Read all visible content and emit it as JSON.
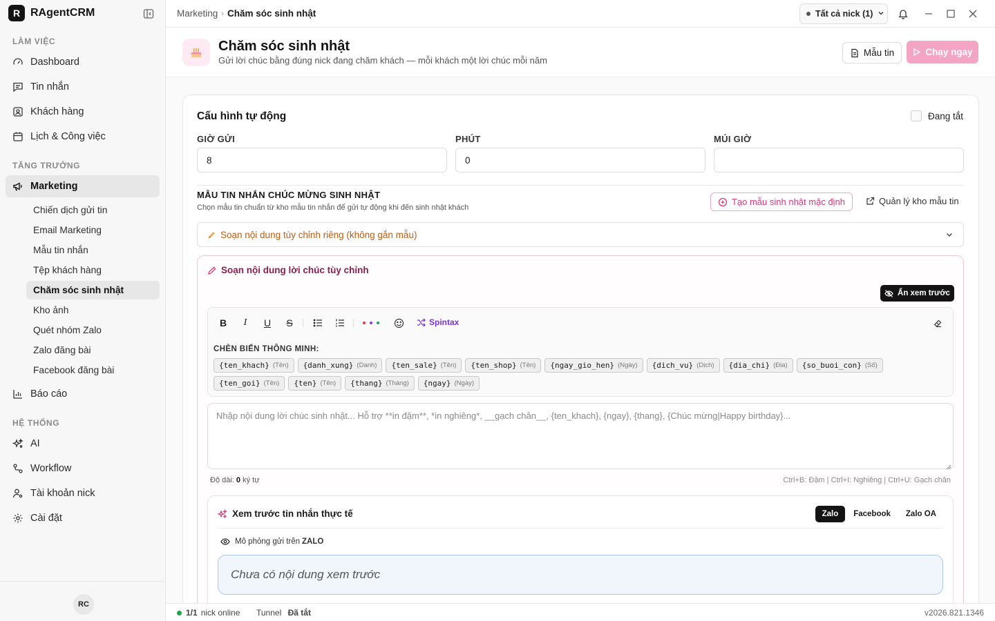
{
  "app": {
    "logo_letter": "R",
    "name": "RAgentCRM"
  },
  "sidebar": {
    "section_work": "LÀM VIỆC",
    "section_growth": "TĂNG TRƯỞNG",
    "section_system": "HỆ THỐNG",
    "items": {
      "dashboard": "Dashboard",
      "messages": "Tin nhắn",
      "customers": "Khách hàng",
      "calendar": "Lịch & Công việc",
      "marketing": "Marketing",
      "reports": "Báo cáo",
      "ai": "AI",
      "workflow": "Workflow",
      "accounts": "Tài khoản nick",
      "settings": "Cài đặt"
    },
    "marketing_sub": {
      "campaign": "Chiến dịch gửi tin",
      "email": "Email Marketing",
      "templates": "Mẫu tin nhắn",
      "segments": "Tệp khách hàng",
      "birthday": "Chăm sóc sinh nhật",
      "images": "Kho ảnh",
      "zalo_groups": "Quét nhóm Zalo",
      "zalo_post": "Zalo đăng bài",
      "fb_post": "Facebook đăng bài"
    },
    "avatar": "RC"
  },
  "topbar": {
    "breadcrumb_parent": "Marketing",
    "breadcrumb_current": "Chăm sóc sinh nhật",
    "nick_select": "Tất cả nick (1)"
  },
  "page": {
    "title": "Chăm sóc sinh nhật",
    "subtitle": "Gửi lời chúc bằng đúng nick đang chăm khách — mỗi khách một lời chúc mỗi năm",
    "template_button": "Mẫu tin",
    "run_button": "Chạy ngay"
  },
  "config": {
    "title": "Cấu hình tự động",
    "toggle_label": "Đang tắt",
    "hour_label": "GIỜ GỬI",
    "hour_value": "8",
    "minute_label": "PHÚT",
    "minute_value": "0",
    "timezone_label": "MÚI GIỜ",
    "timezone_value": ""
  },
  "template_section": {
    "title": "MẪU TIN NHẮN CHÚC MỪNG SINH NHẬT",
    "subtitle": "Chọn mẫu tin chuẩn từ kho mẫu tin nhắn để gửi tự động khi đến sinh nhật khách",
    "create_default": "Tạo mẫu sinh nhật mặc định",
    "manage_link": "Quản lý kho mẫu tin",
    "select_value": "Soạn nội dung tùy chỉnh riêng (không gắn mẫu)"
  },
  "composer": {
    "title": "Soạn nội dung lời chúc tùy chỉnh",
    "hide_preview": "Ẩn xem trước",
    "spintax": "Spintax",
    "vars_label": "CHÈN BIẾN THÔNG MINH:",
    "variables": [
      {
        "code": "{ten_khach}",
        "hint": "(Tên)"
      },
      {
        "code": "{danh_xung}",
        "hint": "(Danh)"
      },
      {
        "code": "{ten_sale}",
        "hint": "(Tên)"
      },
      {
        "code": "{ten_shop}",
        "hint": "(Tên)"
      },
      {
        "code": "{ngay_gio_hen}",
        "hint": "(Ngày)"
      },
      {
        "code": "{dich_vu}",
        "hint": "(Dịch)"
      },
      {
        "code": "{dia_chi}",
        "hint": "(Địa)"
      },
      {
        "code": "{so_buoi_con}",
        "hint": "(Số)"
      },
      {
        "code": "{ten_goi}",
        "hint": "(Tên)"
      },
      {
        "code": "{ten}",
        "hint": "(Tên)"
      },
      {
        "code": "{thang}",
        "hint": "(Tháng)"
      },
      {
        "code": "{ngay}",
        "hint": "(Ngày)"
      }
    ],
    "placeholder": "Nhập nội dung lời chúc sinh nhật... Hỗ trợ **in đậm**, *in nghiêng*, __gạch chân__, {ten_khach}, {ngay}, {thang}, {Chúc mừng|Happy birthday}...",
    "length_label": "Độ dài:",
    "length_value": "0",
    "length_unit": "ký tự",
    "shortcuts": "Ctrl+B: Đậm | Ctrl+I: Nghiêng | Ctrl+U: Gạch chân"
  },
  "preview": {
    "title": "Xem trước tin nhắn thực tế",
    "tabs": [
      "Zalo",
      "Facebook",
      "Zalo OA"
    ],
    "sim_label": "Mô phỏng gửi trên",
    "sim_platform": "ZALO",
    "empty": "Chưa có nội dung xem trước"
  },
  "status": {
    "online_count": "1/1",
    "online_label": "nick online",
    "tunnel_label": "Tunnel",
    "tunnel_state": "Đã tắt",
    "version": "v2026.821.1346"
  },
  "colors": {
    "accent_pink": "#d63b78",
    "run_button": "#f3a5c3",
    "online_green": "#1fa34a",
    "spintax_purple": "#7a34d9",
    "custom_select_orange": "#c45b12"
  }
}
